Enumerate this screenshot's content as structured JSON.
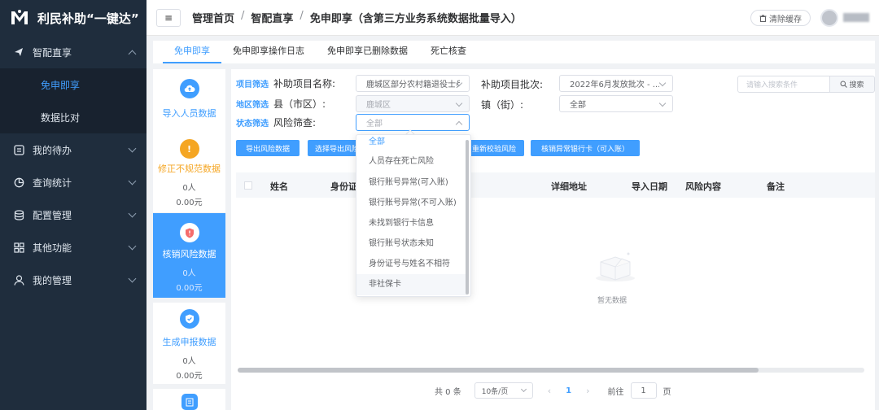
{
  "brand": {
    "title": "利民补助“一键达”"
  },
  "sidebar": {
    "items": [
      {
        "label": "智配直享",
        "icon": "send-icon",
        "expanded": true,
        "children": [
          {
            "label": "免申即享",
            "active": true
          },
          {
            "label": "数据比对",
            "active": false
          }
        ]
      },
      {
        "label": "我的待办",
        "icon": "todo-icon"
      },
      {
        "label": "查询统计",
        "icon": "pie-chart-icon"
      },
      {
        "label": "配置管理",
        "icon": "database-icon"
      },
      {
        "label": "其他功能",
        "icon": "grid-icon"
      },
      {
        "label": "我的管理",
        "icon": "user-icon"
      }
    ]
  },
  "header": {
    "menu_icon": "≡",
    "breadcrumbs": [
      "管理首页",
      "智配直享",
      "免申即享（含第三方业务系统数据批量导入）"
    ],
    "clear_cache_label": "清除缓存"
  },
  "tabs": [
    "免申即享",
    "免申即享操作日志",
    "免申即享已删除数据",
    "死亡核查"
  ],
  "cards": [
    {
      "title": "导入人员数据",
      "icon": "cloud-upload-icon",
      "color": "#409eff"
    },
    {
      "title": "修正不规范数据",
      "icon": "warning-icon",
      "color": "#f5a623",
      "count": "0人",
      "amount": "0.00元"
    },
    {
      "title": "核销风险数据",
      "icon": "shield-icon",
      "color": "#f56c6c",
      "count": "0人",
      "amount": "0.00元",
      "active": true
    },
    {
      "title": "生成申报数据",
      "icon": "check-shield-icon",
      "color": "#409eff",
      "count": "0人",
      "amount": "0.00元"
    }
  ],
  "filters": {
    "project_tag": "项目筛选",
    "region_tag": "地区筛选",
    "status_tag": "状态筛选",
    "project_name_label": "补助项目名称:",
    "project_name_value": "鹿城区部分农村籍退役士兵",
    "batch_label": "补助项目批次:",
    "batch_value": "2022年6月发放批次 - ...",
    "county_label": "县（市区）:",
    "county_value": "鹿城区",
    "town_label": "镇（街）:",
    "town_value": "全部",
    "risk_label": "风险筛查:",
    "risk_value": "全部"
  },
  "search": {
    "placeholder": "请输入搜索条件",
    "button_label": "搜索"
  },
  "actions": [
    "导出风险数据",
    "选择导出风险",
    "重新校验风险",
    "核销异常银行卡（可入账）"
  ],
  "dropdown": {
    "options": [
      "全部",
      "人员存在死亡风险",
      "银行账号异常(可入账)",
      "银行账号异常(不可入账)",
      "未找到银行卡信息",
      "银行账号状态未知",
      "身份证号与姓名不相符",
      "非社保卡"
    ],
    "selected": "全部",
    "hovered": "非社保卡"
  },
  "table": {
    "columns": [
      "姓名",
      "身份证",
      "详细地址",
      "导入日期",
      "风险内容",
      "备注"
    ],
    "empty_text": "暂无数据"
  },
  "pagination": {
    "total_text": "共 0 条",
    "page_size": "10条/页",
    "current_page": "1",
    "goto_label": "前往",
    "goto_value": "1",
    "page_unit": "页"
  },
  "colors": {
    "sidebar_bg": "#1f2d3d",
    "accent": "#409eff",
    "warning": "#f5a623",
    "danger": "#f56c6c"
  }
}
